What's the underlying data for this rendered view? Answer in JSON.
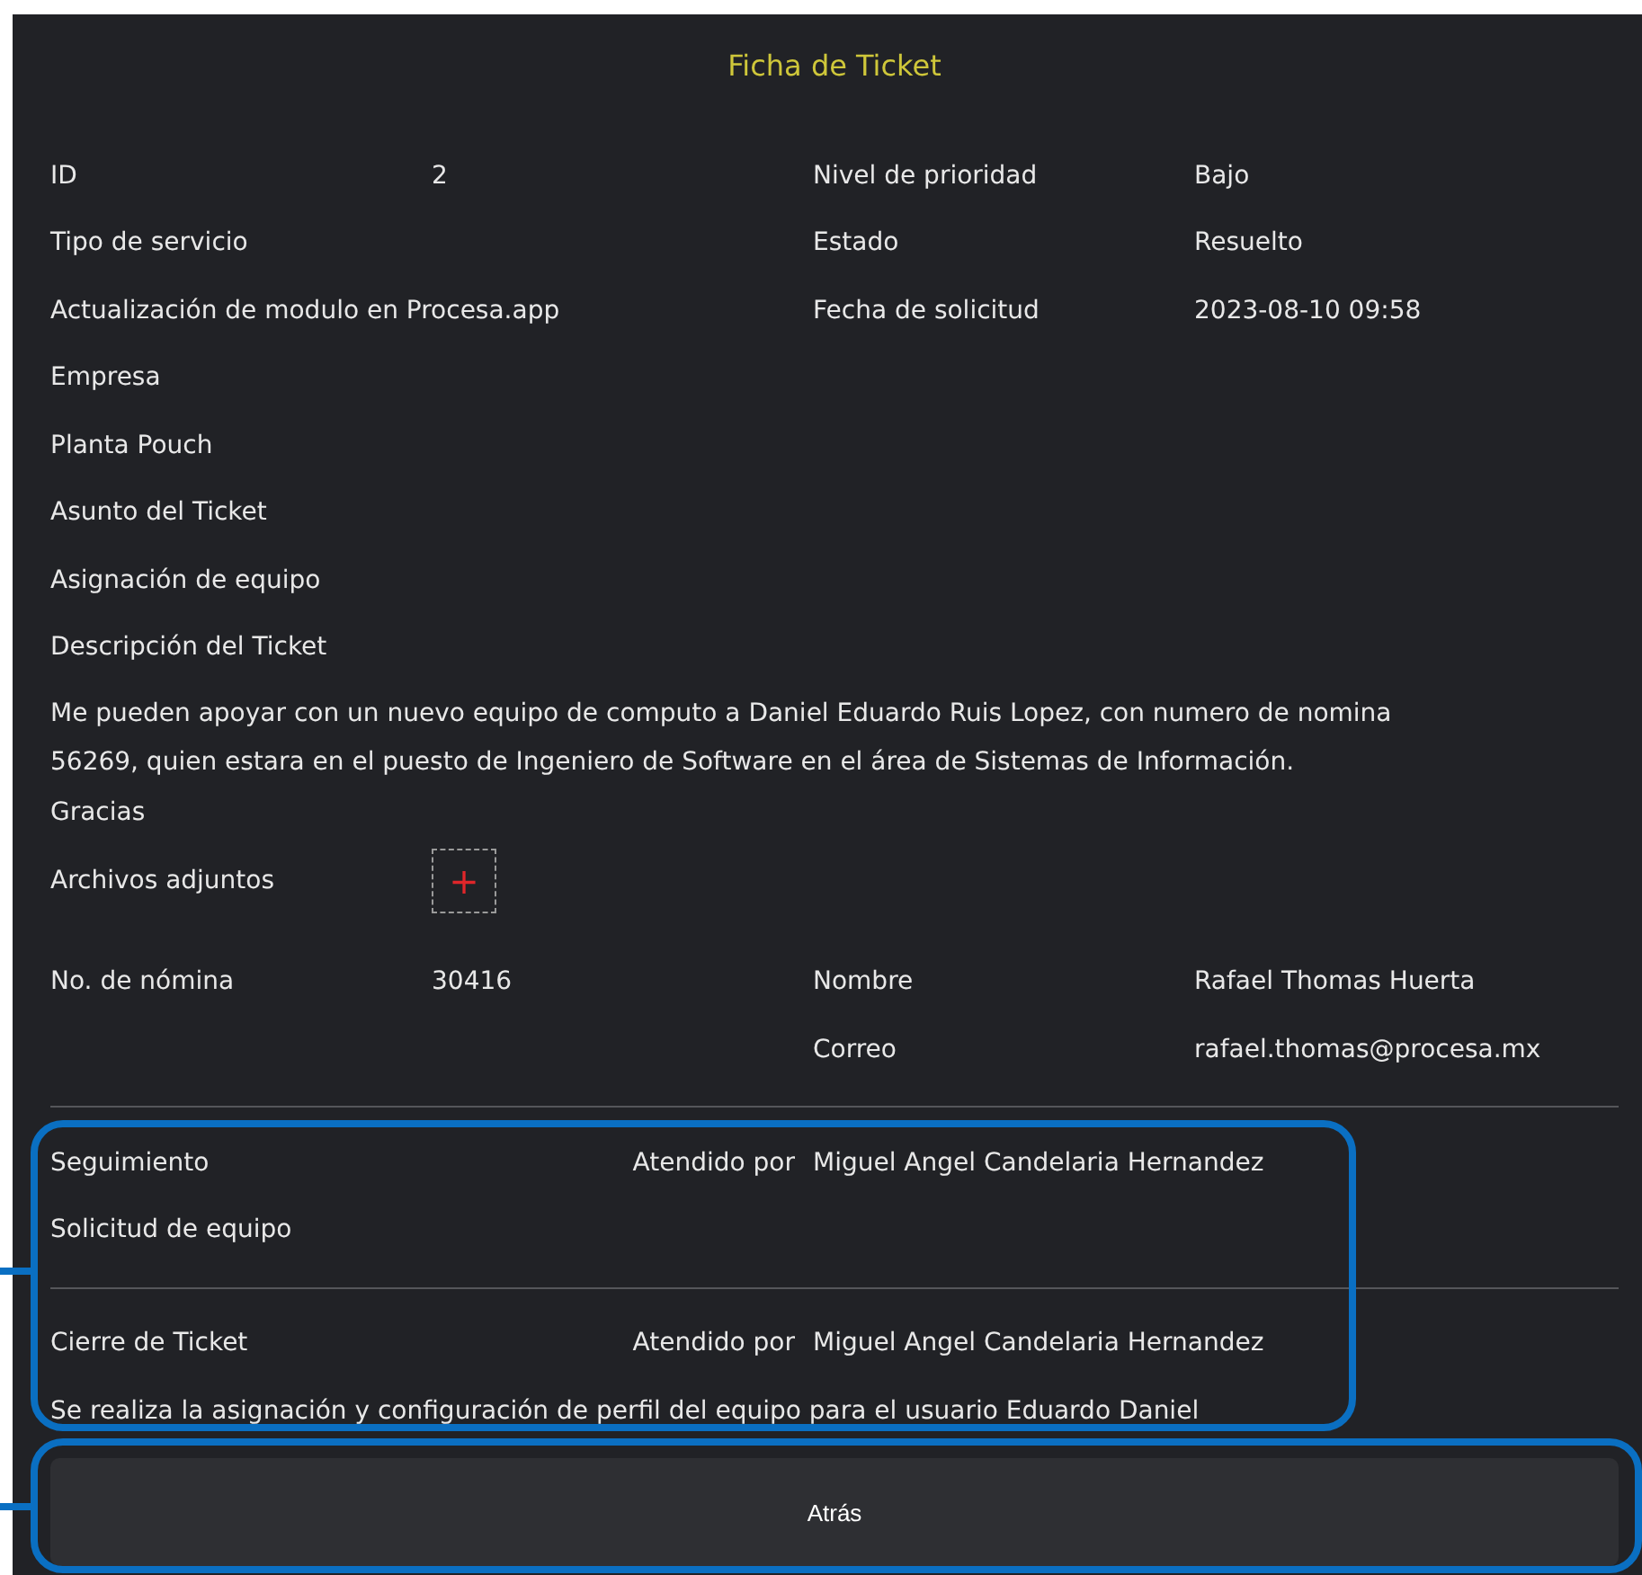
{
  "title": "Ficha de Ticket",
  "summary_rows": [
    {
      "left_label": "ID",
      "left_value": "2",
      "right_label": "Nivel de prioridad",
      "right_value": "Bajo"
    },
    {
      "left_label": "Tipo de servicio",
      "right_label": "Estado",
      "right_value": "Resuelto"
    },
    {
      "left_label": "Actualización de modulo en Procesa.app",
      "right_label": "Fecha de solicitud",
      "right_value": "2023-08-10 09:58"
    }
  ],
  "detail_lines": [
    "Empresa",
    "Planta Pouch",
    "Asunto del Ticket",
    "Asignación de equipo",
    "Descripción del Ticket"
  ],
  "description_lines": [
    "Me pueden apoyar con un nuevo equipo de computo a Daniel Eduardo Ruis Lopez, con numero de nomina",
    "56269, quien estara en el puesto de Ingeniero de Software en el área de Sistemas de Información.",
    "Gracias"
  ],
  "attachments": {
    "label": "Archivos adjuntos",
    "add_button": "+"
  },
  "contact_rows": [
    {
      "left_label": "No. de nómina",
      "left_value": "30416",
      "right_label": "Nombre",
      "right_value": "Rafael Thomas Huerta"
    },
    {
      "right_label": "Correo",
      "right_value": "rafael.thomas@procesa.mx"
    }
  ],
  "followups": [
    {
      "title": "Seguimiento",
      "attended_label": "Atendido por",
      "attended_by": "Miguel Angel Candelaria Hernandez",
      "text": "Solicitud de equipo"
    },
    {
      "title": "Cierre de Ticket",
      "attended_label": "Atendido por",
      "attended_by": "Miguel Angel Candelaria Hernandez",
      "text": "Se realiza la asignación y configuración de perfil del equipo para el usuario Eduardo Daniel"
    }
  ],
  "back_button": "Atrás"
}
